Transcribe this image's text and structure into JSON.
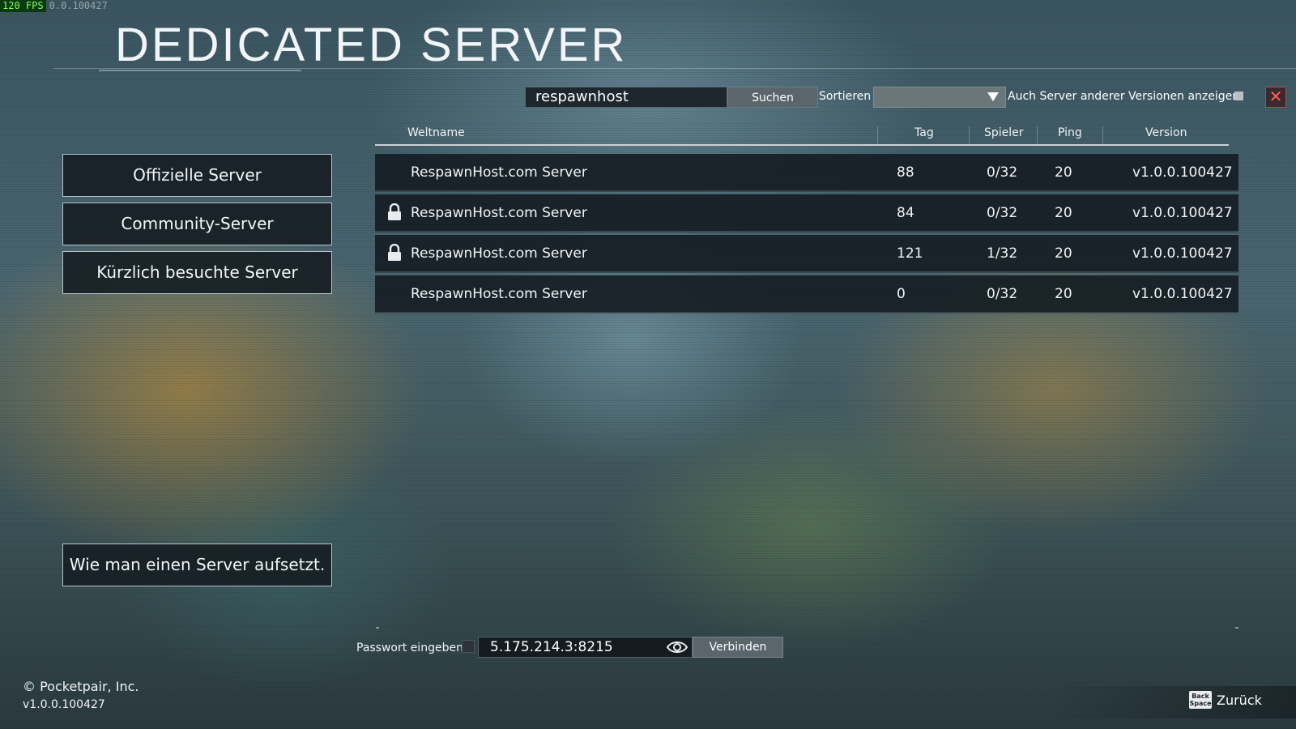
{
  "overlay": {
    "fps": "120 FPS",
    "build": "0.0.100427"
  },
  "header": {
    "title": "DEDICATED SERVER"
  },
  "search": {
    "value": "respawnhost",
    "button": "Suchen"
  },
  "sort": {
    "label": "Sortieren",
    "value": ""
  },
  "filter": {
    "other_versions_label": "Auch Server anderer Versionen anzeigen",
    "checked": false
  },
  "sidebar": {
    "items": [
      {
        "label": "Offizielle Server"
      },
      {
        "label": "Community-Server"
      },
      {
        "label": "Kürzlich besuchte Server"
      }
    ],
    "howto": "Wie man einen Server aufsetzt."
  },
  "table": {
    "headers": {
      "name": "Weltname",
      "day": "Tag",
      "players": "Spieler",
      "ping": "Ping",
      "version": "Version"
    },
    "rows": [
      {
        "locked": false,
        "name": "RespawnHost.com Server",
        "day": "88",
        "players": "0/32",
        "ping": "20",
        "version": "v1.0.0.100427"
      },
      {
        "locked": true,
        "name": "RespawnHost.com Server",
        "day": "84",
        "players": "0/32",
        "ping": "20",
        "version": "v1.0.0.100427"
      },
      {
        "locked": true,
        "name": "RespawnHost.com Server",
        "day": "121",
        "players": "1/32",
        "ping": "20",
        "version": "v1.0.0.100427"
      },
      {
        "locked": false,
        "name": "RespawnHost.com Server",
        "day": "0",
        "players": "0/32",
        "ping": "20",
        "version": "v1.0.0.100427"
      }
    ]
  },
  "connect": {
    "password_label": "Passwort eingeben",
    "address": "5.175.214.3:8215",
    "button": "Verbinden"
  },
  "footer": {
    "copyright": "© Pocketpair, Inc.",
    "version": "v1.0.0.100427",
    "back_key": "Back Space",
    "back_label": "Zurück"
  }
}
